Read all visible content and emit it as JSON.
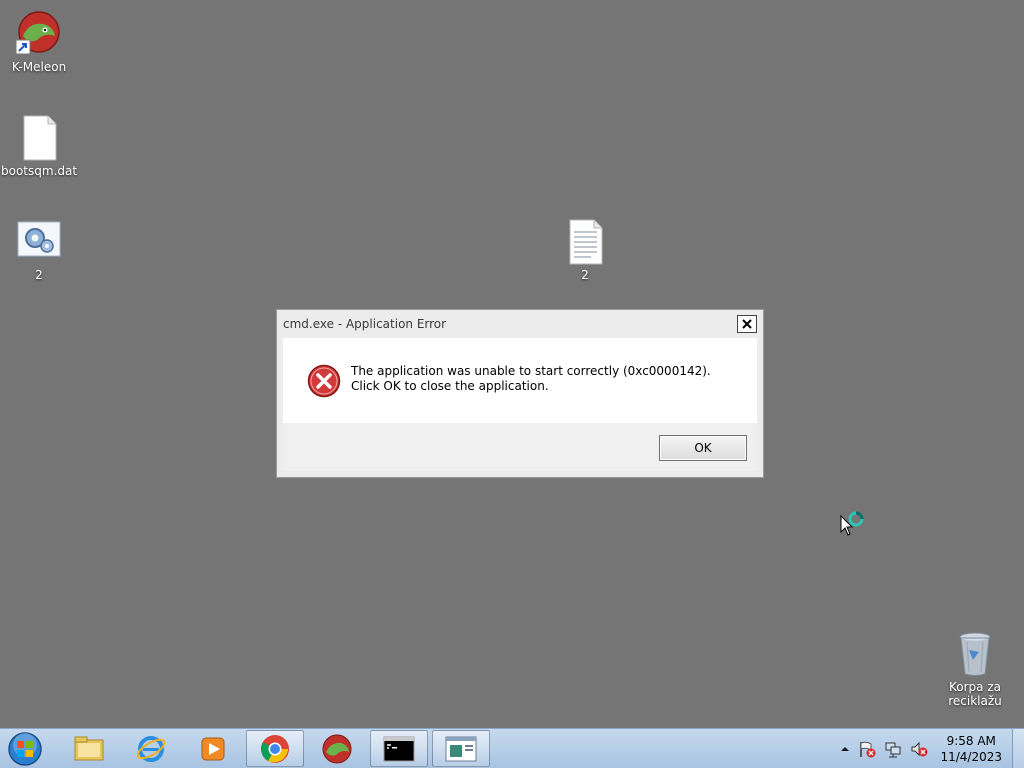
{
  "desktop": {
    "icons": [
      {
        "label": "K-Meleon"
      },
      {
        "label": "bootsqm.dat"
      },
      {
        "label": "2"
      },
      {
        "label": "2"
      },
      {
        "label": "Korpa za reciklažu"
      }
    ]
  },
  "dialog": {
    "title": "cmd.exe - Application Error",
    "message": "The application was unable to start correctly (0xc0000142). Click OK to close the application.",
    "ok_label": "OK"
  },
  "taskbar": {
    "clock_time": "9:58 AM",
    "clock_date": "11/4/2023"
  },
  "colors": {
    "desktop_bg": "#757575",
    "taskbar_bg": "#b6cde6",
    "error_red": "#c8262c"
  }
}
